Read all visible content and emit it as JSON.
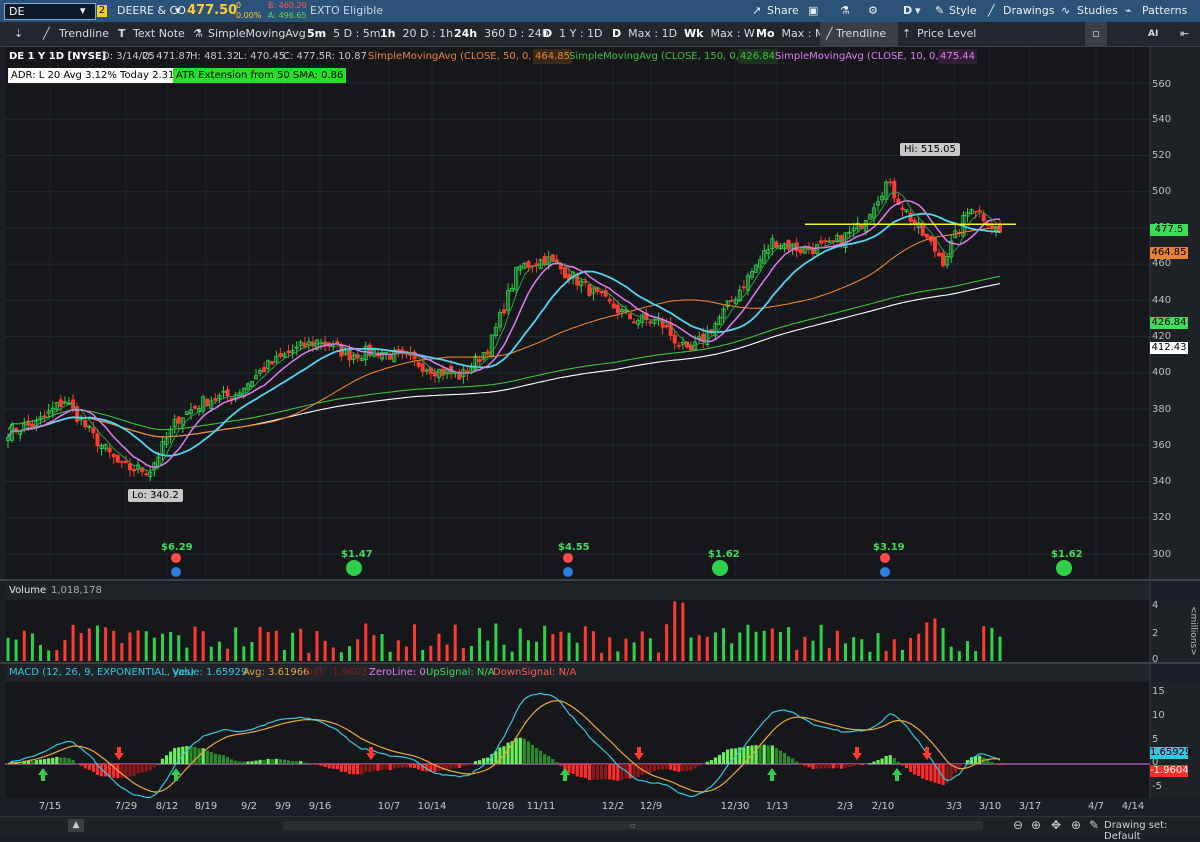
{
  "topbar": {
    "symbol": "DE",
    "link_number": "2",
    "company": "DEERE & CO",
    "last": "477.50",
    "change": "0",
    "change_pct": "0.00%",
    "bid": "B: 460.20",
    "ask": "A: 496.65",
    "exto": "EXTO Eligible",
    "share": "Share",
    "mode": "D",
    "style": "Style",
    "drawings": "Drawings",
    "studies": "Studies",
    "patterns": "Patterns",
    "colors": {
      "bar": "#2c5278",
      "last": "#ffcc33",
      "bid": "#ff5555",
      "ask": "#55dd55"
    }
  },
  "toolbar": {
    "trendline": "Trendline",
    "textnote": "Text Note",
    "sma": "SimpleMovingAvg",
    "tf1_key": "5m",
    "tf1": "5 D : 5m",
    "tf2_key": "1h",
    "tf2": "20 D : 1h",
    "tf3_key": "24h",
    "tf3": "360 D : 24h",
    "tf4_key": "D",
    "tf4": "1 Y : 1D",
    "tf5_key": "D",
    "tf5": "Max : 1D",
    "tf6_key": "Wk",
    "tf6": "Max : W",
    "tf7_key": "Mo",
    "tf7": "Max : M",
    "trendline2": "Trendline",
    "price_level": "Price Level",
    "ai": "AI"
  },
  "header": {
    "title": "DE 1 Y 1D [NYSE]",
    "date": "D: 3/14/25",
    "open": "O: 471.87",
    "high": "H: 481.32",
    "low": "L: 470.45",
    "close": "C: 477.5",
    "range": "R: 10.87",
    "sma50": "SimpleMovingAvg (CLOSE, 50, 0, no)",
    "sma50_val": "464.85",
    "sma150": "SimpleMovingAvg (CLOSE, 150, 0, no)",
    "sma150_val": "426.84",
    "sma10": "SimpleMovingAvg (CLOSE, 10, 0, no)",
    "sma10_val": "475.44",
    "adr": "ADR: L 20  Avg 3.12%  Today 2.31%",
    "atr": "ATR Extension from 50 SMA: 0.86"
  },
  "price_axis": {
    "ticks": [
      "560",
      "540",
      "520",
      "500",
      "480",
      "460",
      "440",
      "420",
      "400",
      "380",
      "360",
      "340",
      "320",
      "300"
    ],
    "tags": [
      {
        "label": "477.5",
        "value": 477.5,
        "color": "#3ddc5a"
      },
      {
        "label": "464.85",
        "value": 464.85,
        "color": "#e8822c"
      },
      {
        "label": "426.84",
        "value": 426.84,
        "color": "#3ddc5a"
      },
      {
        "label": "412.43",
        "value": 412.43,
        "color": "#ffffff"
      }
    ]
  },
  "annotations": {
    "high_label": "Hi: 515.05",
    "low_label": "Lo: 340.2",
    "dividends": [
      "$6.29",
      "$1.47",
      "$4.55",
      "$1.62",
      "$3.19",
      "$1.62"
    ]
  },
  "volume": {
    "label": "Volume",
    "value": "1,018,178",
    "ticks": [
      "4",
      "2",
      "0"
    ],
    "unit": "<millions>"
  },
  "macd": {
    "label": "MACD (12, 26, 9, EXPONENTIAL, yes)",
    "value": "Value: 1.65929",
    "avg": "Avg: 3.61966",
    "diff": "Diff: -1.96037",
    "zeroline": "ZeroLine: 0",
    "upsignal": "UpSignal: N/A",
    "downsignal": "DownSignal: N/A",
    "ticks": [
      "15",
      "10",
      "5",
      "0",
      "-5"
    ],
    "tag_value": "1.65929",
    "tag_diff": "-1.9604"
  },
  "footer": {
    "drawing_set": "Drawing set: Default"
  },
  "chart_data": {
    "type": "candlestick",
    "symbol": "DE",
    "timeframe": "1 Y : 1D",
    "ylim": [
      290,
      570
    ],
    "x_tick_labels": [
      "7/15",
      "7/29",
      "8/12",
      "8/19",
      "9/2",
      "9/9",
      "9/16",
      "10/7",
      "10/14",
      "10/28",
      "11/11",
      "12/2",
      "12/9",
      "12/30",
      "1/13",
      "2/3",
      "2/10",
      "3/3",
      "3/10",
      "3/17",
      "4/7",
      "4/14"
    ],
    "close_path": [
      {
        "date": "7/8",
        "close": 368
      },
      {
        "date": "7/15",
        "close": 372
      },
      {
        "date": "7/22",
        "close": 385
      },
      {
        "date": "7/29",
        "close": 365
      },
      {
        "date": "8/5",
        "close": 348
      },
      {
        "date": "8/12",
        "close": 346
      },
      {
        "date": "8/19",
        "close": 375
      },
      {
        "date": "8/26",
        "close": 385
      },
      {
        "date": "9/2",
        "close": 388
      },
      {
        "date": "9/9",
        "close": 402
      },
      {
        "date": "9/16",
        "close": 412
      },
      {
        "date": "9/23",
        "close": 418
      },
      {
        "date": "10/7",
        "close": 410
      },
      {
        "date": "10/14",
        "close": 412
      },
      {
        "date": "10/21",
        "close": 408
      },
      {
        "date": "10/28",
        "close": 402
      },
      {
        "date": "11/4",
        "close": 398
      },
      {
        "date": "11/11",
        "close": 415
      },
      {
        "date": "11/18",
        "close": 458
      },
      {
        "date": "11/25",
        "close": 463
      },
      {
        "date": "12/2",
        "close": 452
      },
      {
        "date": "12/9",
        "close": 440
      },
      {
        "date": "12/16",
        "close": 430
      },
      {
        "date": "12/23",
        "close": 428
      },
      {
        "date": "12/30",
        "close": 410
      },
      {
        "date": "1/6",
        "close": 428
      },
      {
        "date": "1/13",
        "close": 450
      },
      {
        "date": "1/21",
        "close": 473
      },
      {
        "date": "1/27",
        "close": 468
      },
      {
        "date": "2/3",
        "close": 470
      },
      {
        "date": "2/10",
        "close": 480
      },
      {
        "date": "2/18",
        "close": 505
      },
      {
        "date": "2/24",
        "close": 482
      },
      {
        "date": "3/3",
        "close": 462
      },
      {
        "date": "3/7",
        "close": 493
      },
      {
        "date": "3/14",
        "close": 477.5
      }
    ],
    "series": [
      {
        "name": "SimpleMovingAvg (CLOSE, 50, 0, no)",
        "last": 464.85,
        "color": "#e8822c"
      },
      {
        "name": "SimpleMovingAvg (CLOSE, 150, 0, no)",
        "last": 426.84,
        "color": "#3fbf3f"
      },
      {
        "name": "SimpleMovingAvg (CLOSE, 10, 0, no)",
        "last": 475.44,
        "color": "#e27bf0"
      }
    ],
    "resistance_level": 482,
    "high": 515.05,
    "low": 340.2,
    "volume_ylim": [
      0,
      4.5
    ],
    "macd_ylim": [
      -7,
      17
    ]
  }
}
